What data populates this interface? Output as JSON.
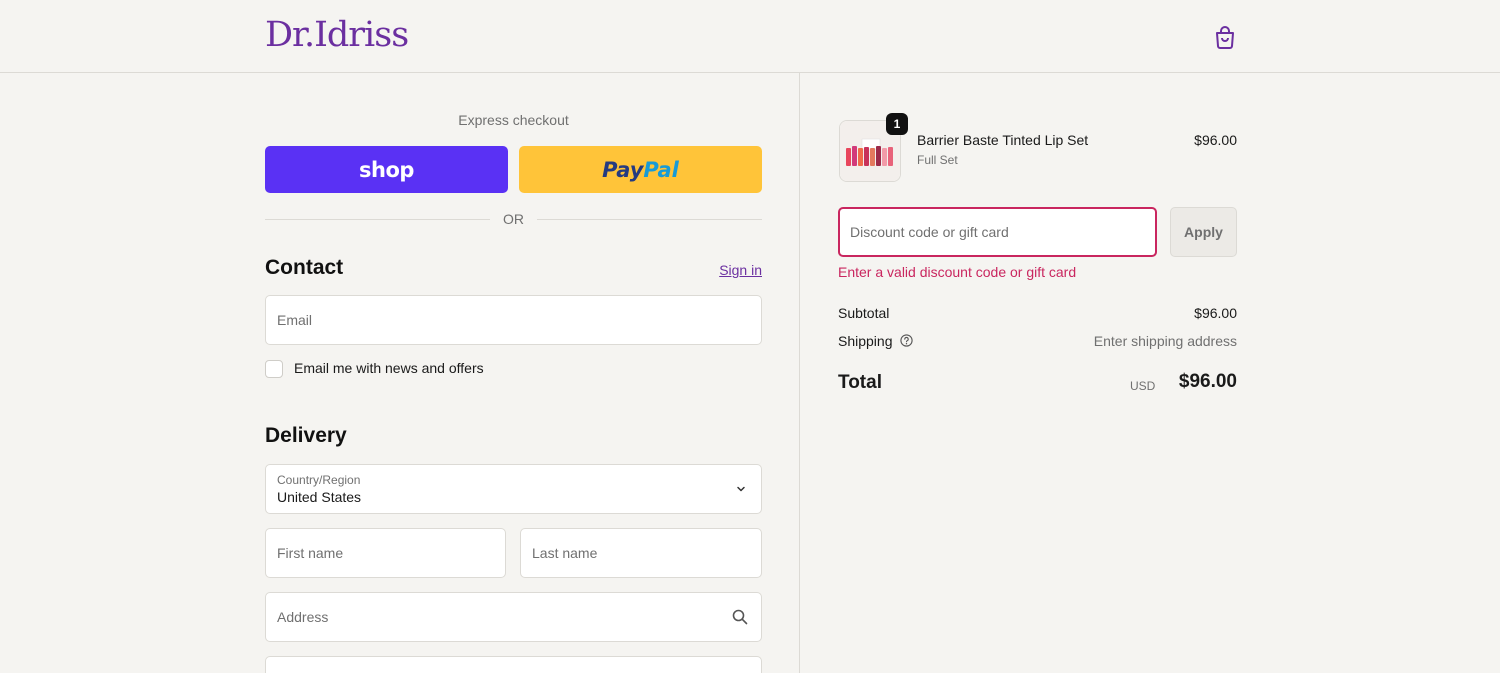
{
  "header": {
    "logo_text": "Dr.Idriss",
    "cart_icon": "shopping-bag-icon"
  },
  "express": {
    "title": "Express checkout",
    "shop_label": "shop",
    "paypal_label_1": "Pay",
    "paypal_label_2": "Pal",
    "or_text": "OR"
  },
  "contact": {
    "title": "Contact",
    "signin_label": "Sign in",
    "email_placeholder": "Email",
    "newsletter_label": "Email me with news and offers",
    "newsletter_checked": false
  },
  "delivery": {
    "title": "Delivery",
    "country_label": "Country/Region",
    "country_value": "United States",
    "first_name_placeholder": "First name",
    "last_name_placeholder": "Last name",
    "address_placeholder": "Address"
  },
  "summary": {
    "item": {
      "quantity": "1",
      "name": "Barrier Baste Tinted Lip Set",
      "variant": "Full Set",
      "price": "$96.00"
    },
    "discount_placeholder": "Discount code or gift card",
    "apply_label": "Apply",
    "discount_error": "Enter a valid discount code or gift card",
    "subtotal_label": "Subtotal",
    "subtotal_value": "$96.00",
    "shipping_label": "Shipping",
    "shipping_value": "Enter shipping address",
    "total_label": "Total",
    "total_currency": "USD",
    "total_value": "$96.00"
  },
  "colors": {
    "brand": "#6b2fa0",
    "shop_pay": "#5a31f4",
    "paypal": "#ffc439",
    "error": "#c9265f"
  }
}
